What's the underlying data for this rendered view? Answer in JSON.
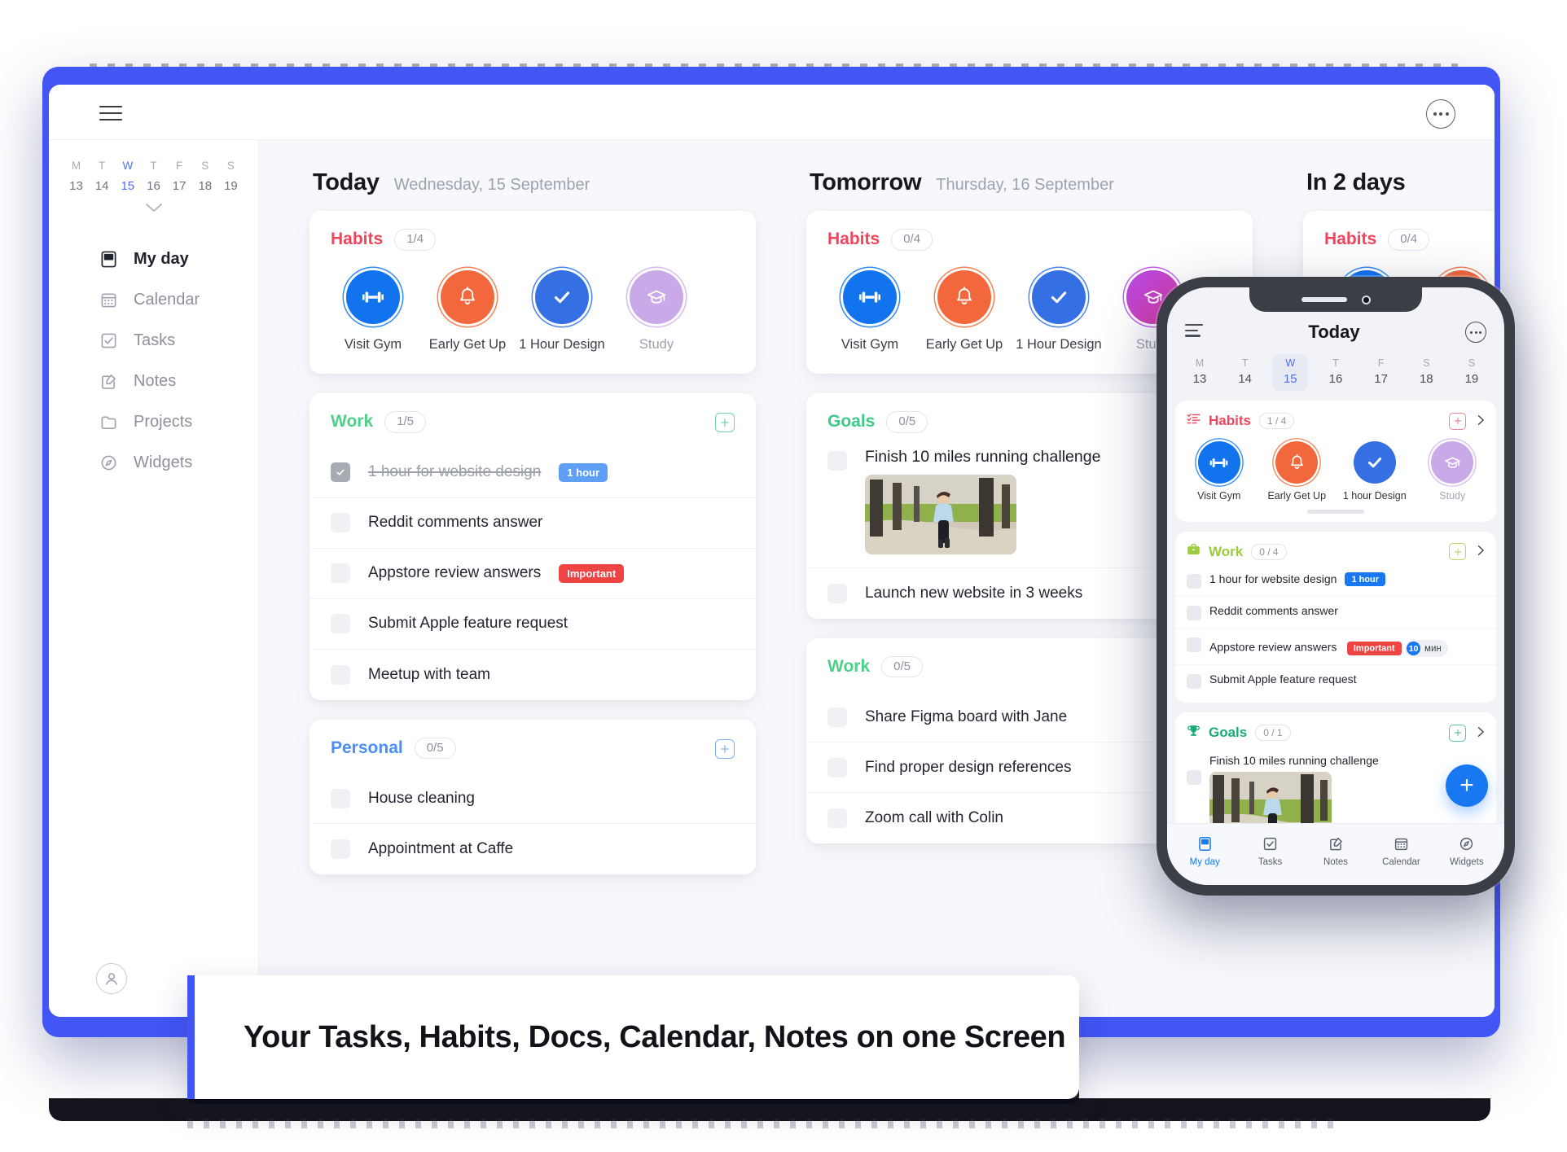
{
  "window": {
    "menu_icon": "hamburger-icon",
    "more_icon": "more-options-icon"
  },
  "sidebar": {
    "week": {
      "day_letters": [
        "M",
        "T",
        "W",
        "T",
        "F",
        "S",
        "S"
      ],
      "day_numbers": [
        "13",
        "14",
        "15",
        "16",
        "17",
        "18",
        "19"
      ],
      "selected_index": 2
    },
    "expand_icon": "chevron-down-icon",
    "items": [
      {
        "label": "My day",
        "icon": "myday-icon",
        "active": true
      },
      {
        "label": "Calendar",
        "icon": "calendar-icon",
        "active": false
      },
      {
        "label": "Tasks",
        "icon": "tasks-icon",
        "active": false
      },
      {
        "label": "Notes",
        "icon": "notes-icon",
        "active": false
      },
      {
        "label": "Projects",
        "icon": "projects-icon",
        "active": false
      },
      {
        "label": "Widgets",
        "icon": "widgets-icon",
        "active": false
      }
    ],
    "avatar": "user-avatar-icon"
  },
  "board": {
    "columns": [
      {
        "title": "Today",
        "date": "Wednesday, 15 September",
        "habits": {
          "title": "Habits",
          "counter": "1/4",
          "items": [
            {
              "label": "Visit Gym",
              "icon": "dumbbell-icon",
              "style": "gym",
              "done": false
            },
            {
              "label": "Early Get Up",
              "icon": "bell-icon",
              "style": "bell",
              "done": false
            },
            {
              "label": "1 Hour Design",
              "icon": "check-icon",
              "style": "check",
              "done": true
            },
            {
              "label": "Study",
              "icon": "graduation-cap-icon",
              "style": "study",
              "done": false
            }
          ]
        },
        "work": {
          "title": "Work",
          "counter": "1/5",
          "add_icon": "plus-square-icon",
          "tasks": [
            {
              "text": "1 hour for website design",
              "done": true,
              "chip": "1 hour",
              "chip_type": "hour"
            },
            {
              "text": "Reddit comments answer",
              "done": false,
              "chip": null,
              "chip_type": null
            },
            {
              "text": "Appstore review answers",
              "done": false,
              "chip": "Important",
              "chip_type": "important"
            },
            {
              "text": "Submit Apple feature request",
              "done": false,
              "chip": null,
              "chip_type": null
            },
            {
              "text": "Meetup with team",
              "done": false,
              "chip": null,
              "chip_type": null
            }
          ]
        },
        "personal": {
          "title": "Personal",
          "counter": "0/5",
          "add_icon": "plus-square-icon",
          "tasks": [
            {
              "text": "House cleaning",
              "done": false
            },
            {
              "text": "Appointment at Caffe",
              "done": false
            }
          ]
        }
      },
      {
        "title": "Tomorrow",
        "date": "Thursday, 16 September",
        "habits": {
          "title": "Habits",
          "counter": "0/4",
          "items": [
            {
              "label": "Visit Gym",
              "icon": "dumbbell-icon",
              "style": "gym",
              "done": false
            },
            {
              "label": "Early Get Up",
              "icon": "bell-icon",
              "style": "bell",
              "done": false
            },
            {
              "label": "1 Hour Design",
              "icon": "check-icon",
              "style": "check",
              "done": false
            },
            {
              "label": "Study",
              "icon": "graduation-cap-icon",
              "style": "study2",
              "done": false
            }
          ]
        },
        "goals": {
          "title": "Goals",
          "counter": "0/5",
          "tasks": [
            {
              "text": "Finish 10 miles running challenge",
              "image": "runner-photo",
              "done": false
            },
            {
              "text": "Launch new website in 3 weeks",
              "image": null,
              "done": false
            }
          ]
        },
        "work": {
          "title": "Work",
          "counter": "0/5",
          "tasks": [
            {
              "text": "Share Figma board with Jane",
              "done": false
            },
            {
              "text": "Find proper design references",
              "done": false
            },
            {
              "text": "Zoom call with Colin",
              "done": false
            }
          ]
        }
      },
      {
        "title": "In 2 days",
        "date": "",
        "habits": {
          "title": "Habits",
          "counter": "0/4",
          "items": [
            {
              "label": "",
              "icon": "dumbbell-icon",
              "style": "gym",
              "done": false
            },
            {
              "label": "",
              "icon": "bell-icon",
              "style": "bell",
              "done": false
            }
          ]
        }
      }
    ]
  },
  "phone": {
    "header": {
      "title": "Today",
      "menu_icon": "hamburger-icon",
      "more_icon": "more-options-icon"
    },
    "week": {
      "day_letters": [
        "M",
        "T",
        "W",
        "T",
        "F",
        "S",
        "S"
      ],
      "day_numbers": [
        "13",
        "14",
        "15",
        "16",
        "17",
        "18",
        "19"
      ],
      "selected_index": 2
    },
    "habits": {
      "title": "Habits",
      "counter": "1 / 4",
      "section_icon": "checklist-icon",
      "add_icon": "plus-square-icon",
      "chevron_icon": "chevron-right-icon",
      "items": [
        {
          "label": "Visit Gym",
          "icon": "dumbbell-icon",
          "style": "gym"
        },
        {
          "label": "Early Get Up",
          "icon": "bell-icon",
          "style": "bell"
        },
        {
          "label": "1 hour Design",
          "icon": "check-icon",
          "style": "check"
        },
        {
          "label": "Study",
          "icon": "graduation-cap-icon",
          "style": "study"
        }
      ]
    },
    "work": {
      "title": "Work",
      "counter": "0 / 4",
      "section_icon": "briefcase-icon",
      "add_icon": "plus-square-icon",
      "chevron_icon": "chevron-right-icon",
      "tasks": [
        {
          "text": "1 hour for website design",
          "chip": "1 hour",
          "chip_type": "hour",
          "minutes": null,
          "minutes_unit": null
        },
        {
          "text": "Reddit comments answer",
          "chip": null,
          "chip_type": null,
          "minutes": null,
          "minutes_unit": null
        },
        {
          "text": "Appstore review answers",
          "chip": "Important",
          "chip_type": "important",
          "minutes": "10",
          "minutes_unit": "мин"
        },
        {
          "text": "Submit Apple feature request",
          "chip": null,
          "chip_type": null,
          "minutes": null,
          "minutes_unit": null
        }
      ]
    },
    "goals": {
      "title": "Goals",
      "counter": "0 / 1",
      "section_icon": "trophy-icon",
      "add_icon": "plus-square-icon",
      "chevron_icon": "chevron-right-icon",
      "tasks": [
        {
          "text": "Finish 10 miles running challenge",
          "image": "runner-photo"
        }
      ]
    },
    "fab": {
      "label": "+",
      "icon": "plus-icon"
    },
    "tabbar": [
      {
        "label": "My day",
        "icon": "myday-icon",
        "active": true
      },
      {
        "label": "Tasks",
        "icon": "tasks-icon",
        "active": false
      },
      {
        "label": "Notes",
        "icon": "notes-icon",
        "active": false
      },
      {
        "label": "Calendar",
        "icon": "calendar-icon",
        "active": false
      },
      {
        "label": "Widgets",
        "icon": "widgets-icon",
        "active": false
      }
    ]
  },
  "caption": {
    "text": "Your Tasks, Habits, Docs, Calendar, Notes on one Screen",
    "accent_color": "#4255f5"
  },
  "colors": {
    "brand_blue": "#4255f5",
    "habits_red": "#f1455c",
    "work_green": "#4fd08a",
    "personal_blue": "#4c8df6",
    "goals_green": "#3fc98a",
    "important_red": "#ef4444",
    "chip_blue": "#5f9ff5",
    "today_blue": "#4c6ef7"
  }
}
